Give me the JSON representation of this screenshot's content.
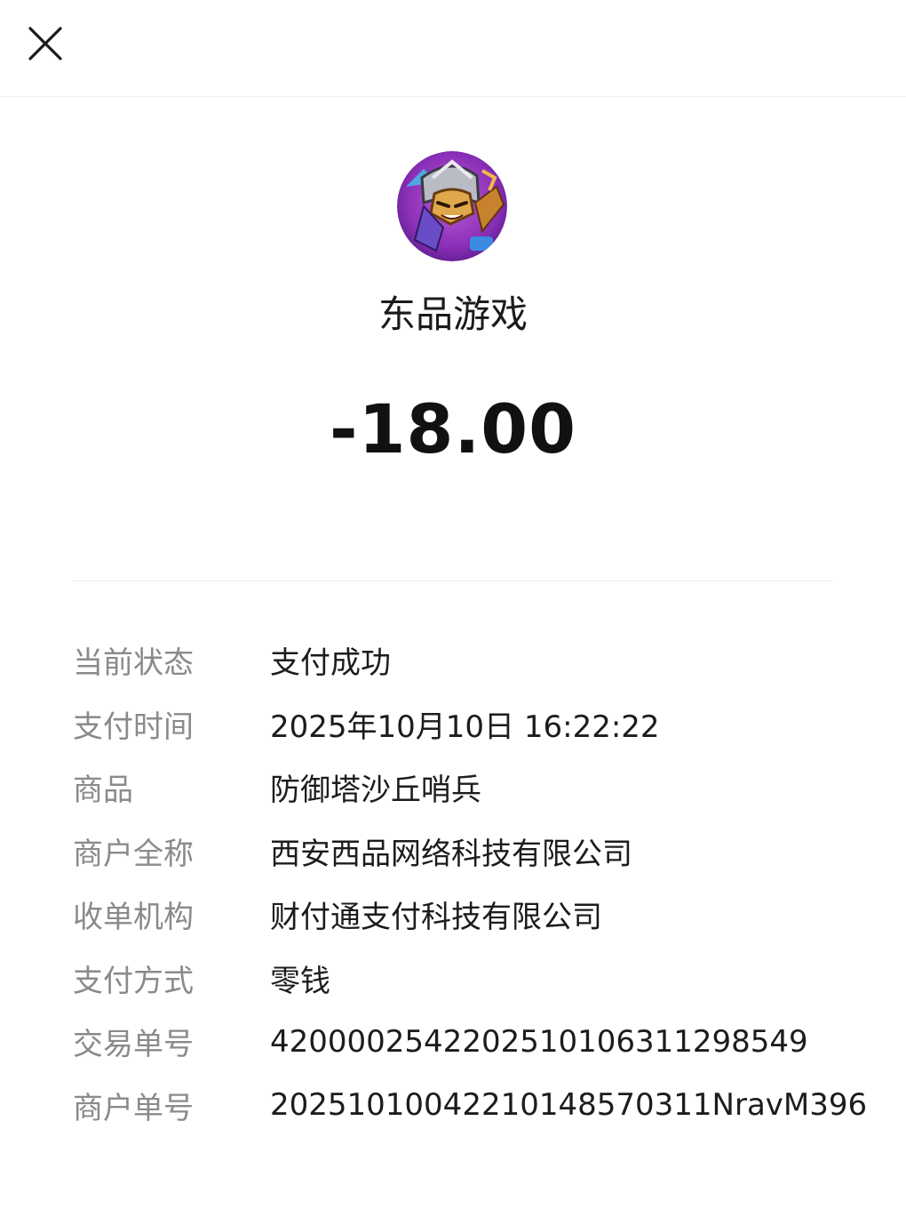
{
  "header": {
    "close_icon": "close-icon"
  },
  "merchant": {
    "avatar_icon": "game-avatar-icon",
    "name": "东品游戏"
  },
  "amount": "-18.00",
  "details": [
    {
      "label": "当前状态",
      "value": "支付成功"
    },
    {
      "label": "支付时间",
      "value": "2025年10月10日 16:22:22"
    },
    {
      "label": "商品",
      "value": "防御塔沙丘哨兵"
    },
    {
      "label": "商户全称",
      "value": "西安西品网络科技有限公司"
    },
    {
      "label": "收单机构",
      "value": "财付通支付科技有限公司"
    },
    {
      "label": "支付方式",
      "value": "零钱"
    },
    {
      "label": "交易单号",
      "value": "4200002542202510106311298549"
    },
    {
      "label": "商户单号",
      "value": "20251010042210148570311NravM396"
    }
  ],
  "colors": {
    "label": "#8a8a8a",
    "value": "#1c1c1c",
    "divider": "#ececec"
  }
}
